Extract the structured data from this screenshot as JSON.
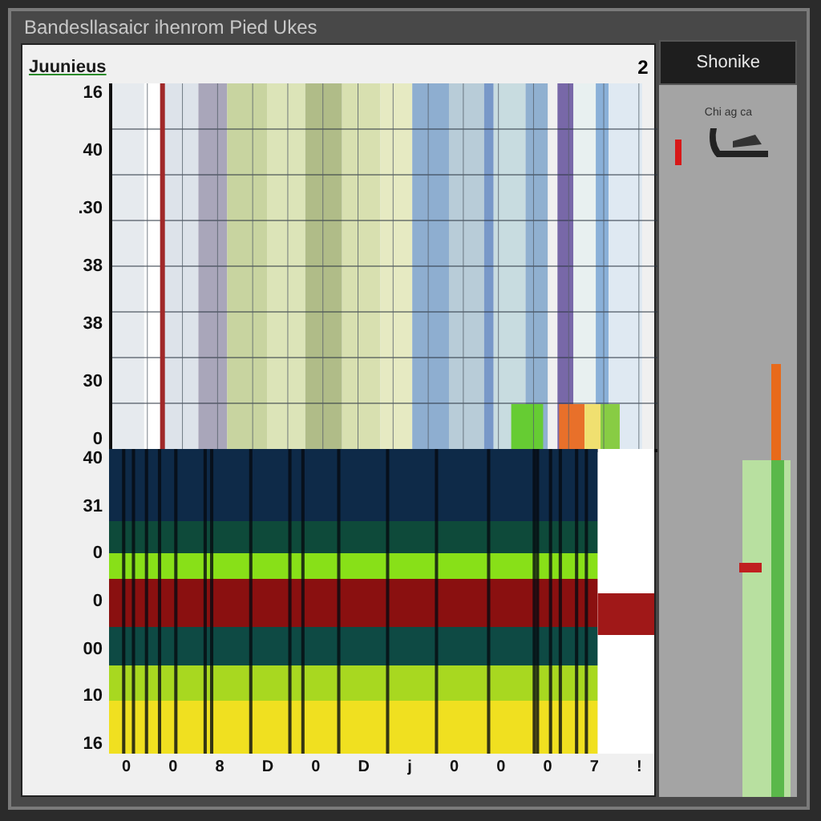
{
  "window": {
    "title": "Bandesllasaicr ihenrom Pied Ukes"
  },
  "chart_panel": {
    "label": "Juunieus",
    "corner_mark": "2",
    "top_y_labels": [
      "16",
      "40",
      ".30",
      "38",
      "38",
      "30",
      "0"
    ],
    "bottom_y_labels": [
      "40",
      "31",
      "0",
      "0",
      "00",
      "10",
      "16"
    ],
    "x_labels": [
      "0",
      "0",
      "8",
      "D",
      "0",
      "D",
      "j",
      "0",
      "0",
      "0",
      "7",
      "!"
    ]
  },
  "side_panel": {
    "title": "Shonike",
    "caption": "Chi ag ca"
  }
}
